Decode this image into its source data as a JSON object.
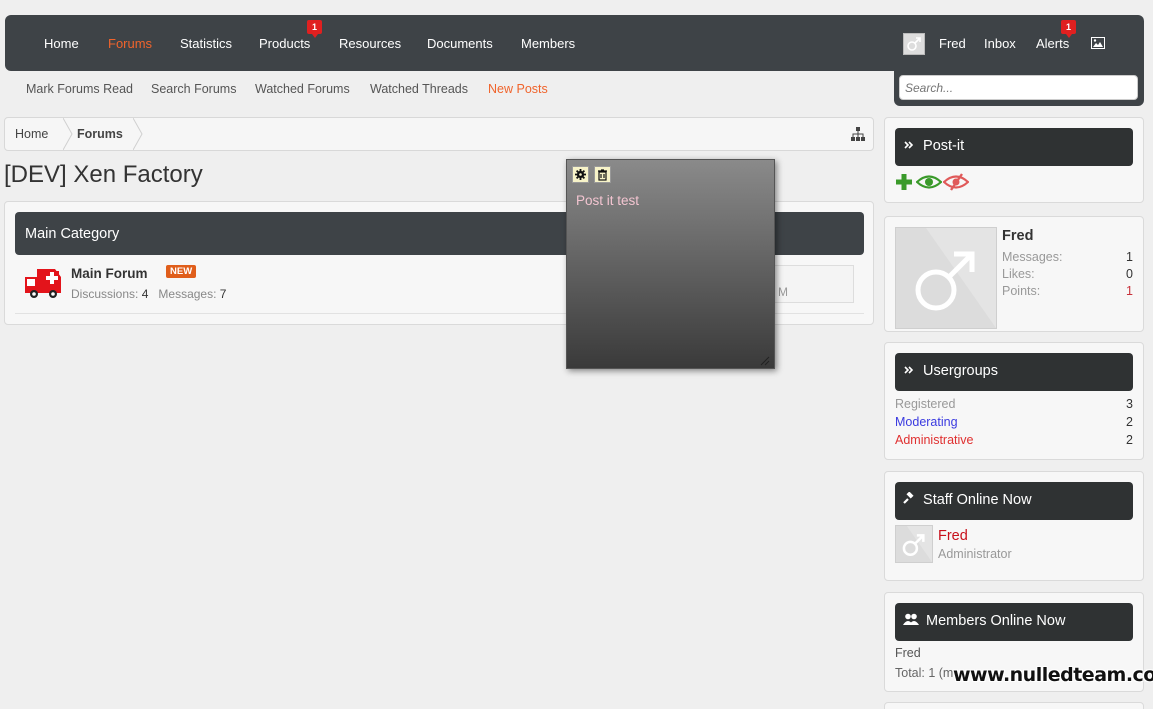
{
  "nav": {
    "items": [
      {
        "label": "Home"
      },
      {
        "label": "Forums"
      },
      {
        "label": "Statistics"
      },
      {
        "label": "Products",
        "badge": "1"
      },
      {
        "label": "Resources"
      },
      {
        "label": "Documents"
      },
      {
        "label": "Members"
      }
    ],
    "user": {
      "name": "Fred",
      "inbox": "Inbox",
      "alerts": "Alerts",
      "alerts_badge": "1"
    },
    "search_placeholder": "Search...",
    "accent": "#f0642c",
    "bar_color": "#3e4347"
  },
  "subnav": {
    "items": [
      "Mark Forums Read",
      "Search Forums",
      "Watched Forums",
      "Watched Threads",
      "New Posts"
    ]
  },
  "breadcrumb": {
    "home": "Home",
    "current": "Forums"
  },
  "page_title": "[DEV] Xen Factory",
  "category": {
    "title": "Main Category",
    "forum": {
      "title": "Main Forum",
      "badge": "NEW",
      "discussions_label": "Discussions:",
      "discussions": "4",
      "messages_label": "Messages:",
      "messages": "7",
      "last_post_fragment": "M"
    }
  },
  "postit_note": {
    "text": "Post it test",
    "icons": [
      "gear-icon",
      "trash-icon"
    ]
  },
  "sidebar": {
    "postit": {
      "title": "Post-it"
    },
    "profile": {
      "name": "Fred",
      "stats": [
        {
          "label": "Messages:",
          "value": "1"
        },
        {
          "label": "Likes:",
          "value": "0"
        },
        {
          "label": "Points:",
          "value": "1"
        }
      ]
    },
    "usergroups": {
      "title": "Usergroups",
      "groups": [
        {
          "label": "Registered",
          "value": "3",
          "color": "#999999"
        },
        {
          "label": "Moderating",
          "value": "2",
          "color": "#3a3ae0"
        },
        {
          "label": "Administrative",
          "value": "2",
          "color": "#e03030"
        }
      ]
    },
    "staff": {
      "title": "Staff Online Now",
      "name": "Fred",
      "role": "Administrator"
    },
    "members_online": {
      "title": "Members Online Now",
      "name": "Fred",
      "total": "Total: 1 (m"
    }
  },
  "watermark": "www.nulledteam.com"
}
